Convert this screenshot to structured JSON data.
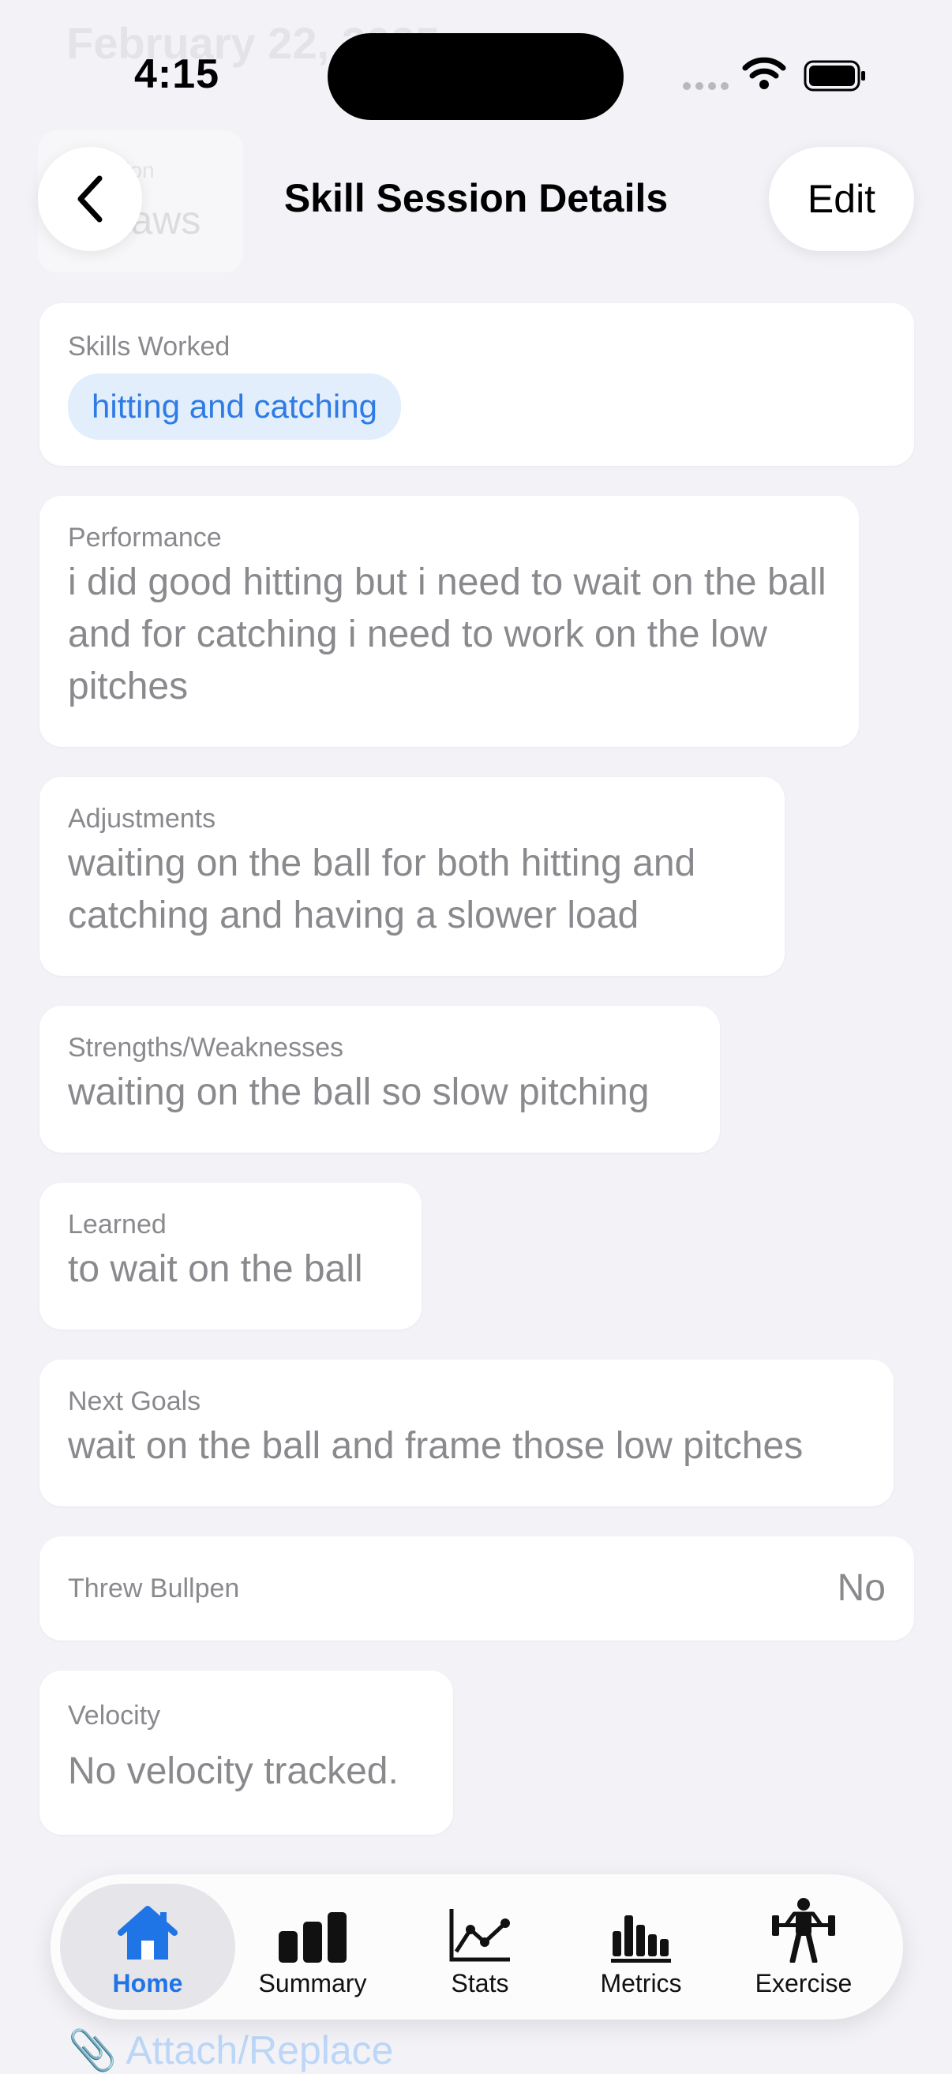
{
  "status": {
    "time": "4:15"
  },
  "background_ghost": {
    "date": "February 22, 2025",
    "sub": "Session",
    "name": "Aikaws"
  },
  "nav": {
    "title": "Skill Session Details",
    "edit": "Edit"
  },
  "skills": {
    "label": "Skills Worked",
    "chip": "hitting and catching"
  },
  "performance": {
    "label": "Performance",
    "value": "i did good hitting but i need to wait on the ball and for catching i need to work on the low pitches"
  },
  "adjustments": {
    "label": "Adjustments",
    "value": "waiting on the ball for both hitting and catching and having a slower load"
  },
  "strengths": {
    "label": "Strengths/Weaknesses",
    "value": "waiting on the ball so slow pitching"
  },
  "learned": {
    "label": "Learned",
    "value": "to wait on the ball"
  },
  "next_goals": {
    "label": "Next Goals",
    "value": "wait on the ball and frame those low pitches"
  },
  "bullpen": {
    "label": "Threw Bullpen",
    "value": "No"
  },
  "velocity": {
    "label": "Velocity",
    "value": "No velocity tracked."
  },
  "attach": {
    "label": "Attach/Replace"
  },
  "tabs": [
    {
      "label": "Home",
      "icon": "house-icon",
      "active": true
    },
    {
      "label": "Summary",
      "icon": "bar-chart-icon"
    },
    {
      "label": "Stats",
      "icon": "line-chart-icon"
    },
    {
      "label": "Metrics",
      "icon": "metrics-bars-icon"
    },
    {
      "label": "Exercise",
      "icon": "weightlifter-icon"
    }
  ],
  "colors": {
    "accent": "#1f74e6",
    "chip_bg": "#e2eefc",
    "background": "#f2f2f7",
    "muted_text": "#8a8a8e"
  }
}
